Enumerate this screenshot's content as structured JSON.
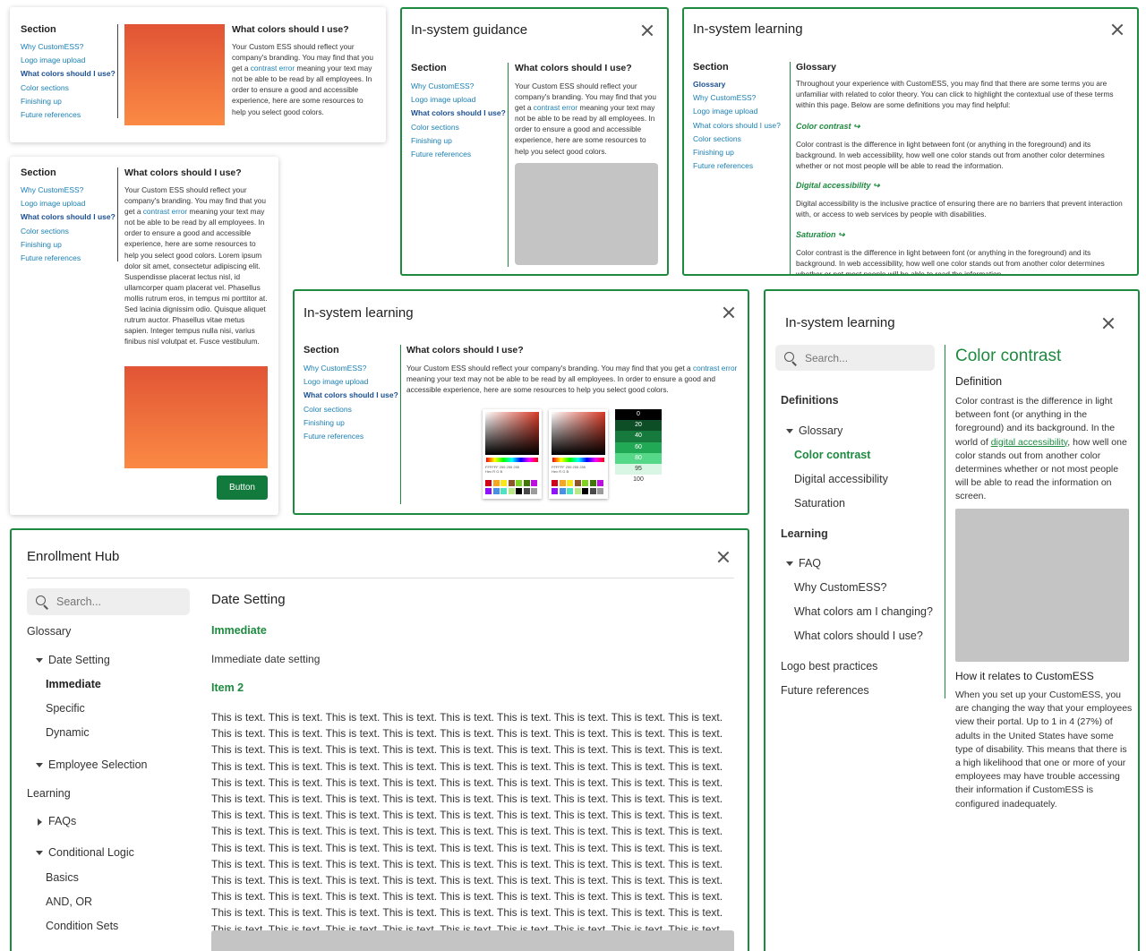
{
  "colors": {
    "accent": "#1d8a3f",
    "link": "#1a7fb3",
    "active_link": "#1a4f90",
    "button": "#137a3d",
    "placeholder_grey": "#c4c4c4",
    "gradient_top": "#e15435",
    "gradient_bottom": "#fb8a44"
  },
  "nav_items": [
    "Why CustomESS?",
    "Logo image upload",
    "What colors should I use?",
    "Color sections",
    "Finishing up",
    "Future references"
  ],
  "card1": {
    "section_label": "Section",
    "heading": "What colors should I use?",
    "para_before": "Your Custom ESS should reflect your company's branding. You may find that you get a ",
    "link": "contrast error",
    "para_after": " meaning your text may not be able to be read by all employees. In order to ensure a good and accessible experience, here are some resources to help you select good colors."
  },
  "card2": {
    "section_label": "Section",
    "heading": "What colors should I use?",
    "para_before": "Your Custom ESS should reflect your company's branding. You may find that you get a ",
    "link": "contrast error",
    "para_after": " meaning your text may not be able to be read by all employees. In order to ensure a good and accessible experience, here are some resources to help you select good colors. Lorem ipsum dolor sit amet, consectetur adipiscing elit. Suspendisse placerat lectus nisl, id ullamcorper quam placerat vel. Phasellus mollis rutrum eros, in tempus mi porttitor at. Sed lacinia dignissim odio. Quisque aliquet rutrum auctor. Phasellus vitae metus sapien. Integer tempus nulla nisi, varius finibus nisl volutpat et. Fusce vestibulum.",
    "button_label": "Button"
  },
  "card3": {
    "title": "In-system guidance",
    "section_label": "Section",
    "heading": "What colors should I use?",
    "para_before": "Your Custom ESS should reflect your company's branding. You may find that you get a ",
    "link": "contrast error",
    "para_after": " meaning your text may not be able to be read by all employees. In order to ensure a good and accessible experience, here are some resources to help you select good colors."
  },
  "card4": {
    "title": "In-system learning",
    "section_label": "Section",
    "nav_items": [
      "Glossary",
      "Why CustomESS?",
      "Logo image upload",
      "What colors should I use?",
      "Color sections",
      "Finishing up",
      "Future references"
    ],
    "heading": "Glossary",
    "intro": "Throughout your experience with CustomESS, you may find that there are some terms you are unfamiliar with related to color theory. You can click to highlight the contextual use of these terms within this page. Below are some definitions you may find helpful:",
    "terms": [
      {
        "term": "Color contrast ↪",
        "definition": "Color contrast is the difference in light between font (or anything in the foreground) and its background. In web accessibility, how well one color stands out from another color determines whether or not most people will be able to read the information."
      },
      {
        "term": "Digital accessibility ↪",
        "definition": "Digital accessibility is the inclusive practice of ensuring there are no barriers that prevent interaction with, or access to web services by people with disabilities."
      },
      {
        "term": "Saturation ↪",
        "definition": "Color contrast is the difference in light between font (or anything in the foreground) and its background. In web accessibility, how well one color stands out from another color determines whether or not most people will be able to read the information."
      }
    ]
  },
  "card5": {
    "title": "In-system learning",
    "section_label": "Section",
    "heading": "What colors should I use?",
    "para_before": "Your Custom ESS should reflect your company's branding. You may find that you get a ",
    "link": "contrast error",
    "para_after": " meaning your text may not be able to be read by all employees. In order to ensure a good and accessible experience, here are some resources to help you select good colors.",
    "picker_values_row1": "FFFFFF   255   255   255",
    "picker_values_row2": "Hex         R       G       B",
    "scale": [
      "0",
      "20",
      "40",
      "60",
      "80",
      "95",
      "100"
    ]
  },
  "card6": {
    "title": "In-system learning",
    "search_placeholder": "Search...",
    "definitions_label": "Definitions",
    "glossary_label": "Glossary",
    "glossary_items": [
      "Color contrast",
      "Digital accessibility",
      "Saturation"
    ],
    "learning_label": "Learning",
    "faq_label": "FAQ",
    "faq_items": [
      "Why CustomESS?",
      "What colors am I changing?",
      "What colors should I use?"
    ],
    "extra_items": [
      "Logo best practices",
      "Future references"
    ],
    "content_title": "Color contrast",
    "definition_label": "Definition",
    "definition_before": "Color contrast is the difference in light between font (or anything in the foreground) and its background. In the world of ",
    "definition_link": "digital accessibility",
    "definition_after": ", how well one color stands out from another color determines whether or not most people will be able to read the information on screen.",
    "relates_label": "How it relates to CustomESS",
    "relates_text": "When you set up your CustomESS, you are changing the way that your employees view their portal. Up to 1 in 4 (27%) of adults in the United States have some type of disability. This means that there is a high likelihood that one or more of your employees may have trouble accessing their information if CustomESS is configured inadequately."
  },
  "card7": {
    "title": "Enrollment Hub",
    "search_placeholder": "Search...",
    "glossary_label": "Glossary",
    "date_setting_label": "Date Setting",
    "date_items": [
      "Immediate",
      "Specific",
      "Dynamic"
    ],
    "employee_selection_label": "Employee Selection",
    "learning_label": "Learning",
    "faqs_label": "FAQs",
    "conditional_logic_label": "Conditional Logic",
    "logic_items": [
      "Basics",
      "AND, OR",
      "Condition Sets"
    ],
    "content_title": "Date Setting",
    "sub1": "Immediate",
    "sub1_text": "Immediate date setting",
    "sub2": "Item 2",
    "body_text": "This is text. This is text. This is text. This is text. This is text. This is text. This is text. This is text. This is text. This is text. This is text. This is text. This is text. This is text. This is text. This is text. This is text. This is text. This is text. This is text. This is text. This is text. This is text. This is text. This is text. This is text. This is text. This is text. This is text. This is text. This is text. This is text. This is text. This is text. This is text. This is text. This is text. This is text. This is text. This is text. This is text. This is text. This is text. This is text. This is text. This is text. This is text. This is text. This is text. This is text. This is text. This is text. This is text. This is text. This is text. This is text. This is text. This is text. This is text. This is text. This is text. This is text. This is text. This is text. This is text. This is text. This is text. This is text. This is text. This is text. This is text. This is text. This is text. This is text. This is text. This is text. This is text. This is text. This is text. This is text. This is text. This is text. This is text. This is text. This is text. This is text. This is text. This is text. This is text. This is text. This is text. This is text. This is text. This is text. This is text. This is text. This is text. This is text. This is text. This is text. This is text. This is text. This is text. This is text. This is text. This is text. This is text. This is text. This is text. This is text. This is text. This is text. This is text. This is text. This is text. This is text. This is text. This is text. This is text. This is text. This is text. This is text. This is text. This is text. This is text. This is text. This is text. This is text. This is text. This is text. This is text."
  }
}
